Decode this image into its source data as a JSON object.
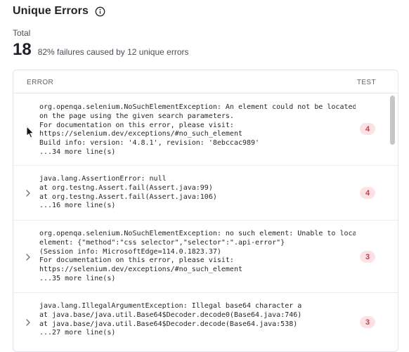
{
  "header": {
    "title": "Unique Errors",
    "info_icon": "info-circle-icon"
  },
  "summary": {
    "total_label": "Total",
    "total_value": "18",
    "description": "82% failures caused by 12 unique errors"
  },
  "table": {
    "columns": {
      "error": "ERROR",
      "test": "TEST"
    },
    "rows": [
      {
        "message": "org.openqa.selenium.NoSuchElementException: An element could not be located\non the page using the given search parameters.\nFor documentation on this error, please visit:\nhttps://selenium.dev/exceptions/#no_such_element\nBuild info: version: '4.8.1', revision: '8ebccac989'\n...34 more line(s)",
        "count": "4"
      },
      {
        "message": "java.lang.AssertionError: null\nat org.testng.Assert.fail(Assert.java:99)\nat org.testng.Assert.fail(Assert.java:106)\n...16 more line(s)",
        "count": "4"
      },
      {
        "message": "org.openqa.selenium.NoSuchElementException: no such element: Unable to locate\nelement: {\"method\":\"css selector\",\"selector\":\".api-error\"}\n(Session info: MicrosoftEdge=114.0.1823.37)\nFor documentation on this error, please visit:\nhttps://selenium.dev/exceptions/#no_such_element\n...35 more line(s)",
        "count": "3"
      },
      {
        "message": "java.lang.IllegalArgumentException: Illegal base64 character a\nat java.base/java.util.Base64$Decoder.decode0(Base64.java:746)\nat java.base/java.util.Base64$Decoder.decode(Base64.java:538)\n...27 more line(s)",
        "count": "3"
      }
    ]
  },
  "colors": {
    "badge_bg": "#fbe3e5",
    "badge_text": "#c6414e",
    "border": "#e3e5e8"
  },
  "icons": {
    "row_expand": "chevron-right-icon",
    "cursor": "mouse-pointer-icon"
  }
}
